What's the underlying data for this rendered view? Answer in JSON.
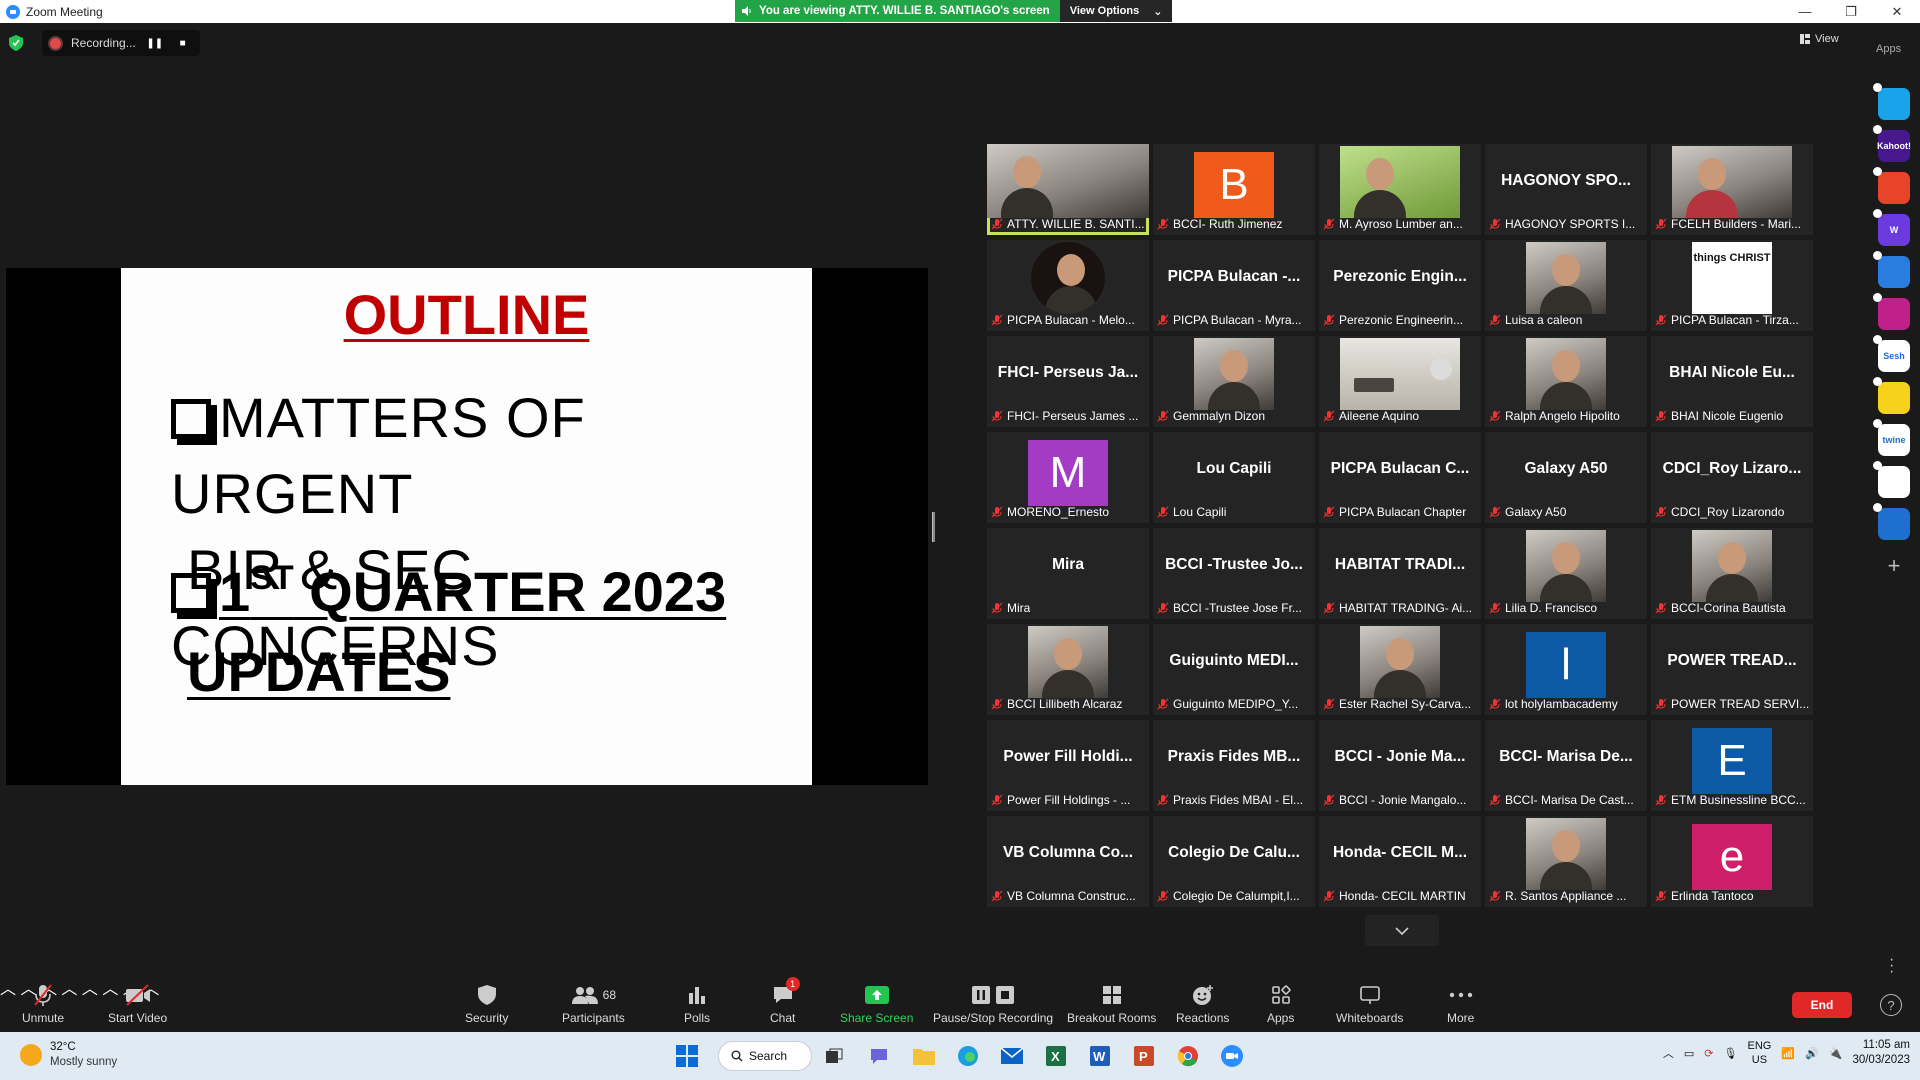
{
  "window": {
    "title": "Zoom Meeting",
    "viewing_banner": "You are viewing ATTY. WILLIE B. SANTIAGO's screen",
    "view_options": "View Options"
  },
  "recording": {
    "label": "Recording..."
  },
  "top_right": {
    "view_label": "View",
    "apps_label": "Apps"
  },
  "slide": {
    "title": "OUTLINE",
    "bullet1_line1": "MATTERS OF URGENT",
    "bullet1_line2": "BIR & SEC CONCERNS",
    "bullet2_num": "1",
    "bullet2_sup": "ST",
    "bullet2_line1": " QUARTER 2023",
    "bullet2_line2": "UPDATES"
  },
  "participants": [
    {
      "name": "ATTY. WILLIE B. SANTI...",
      "display": "photo",
      "active": true
    },
    {
      "name": "BCCI- Ruth Jimenez",
      "display": "letter",
      "letter": "B",
      "color": "#f05a1a"
    },
    {
      "name": "M. Ayroso Lumber an...",
      "display": "photo-green"
    },
    {
      "name": "HAGONOY SPORTS I...",
      "display": "text",
      "tile_text": "HAGONOY  SPO..."
    },
    {
      "name": "FCELH Builders - Mari...",
      "display": "photo-red"
    },
    {
      "name": "PICPA Bulacan - Melo...",
      "display": "photo-circle"
    },
    {
      "name": "PICPA Bulacan - Myra...",
      "display": "text",
      "tile_text": "PICPA  Bulacan  -..."
    },
    {
      "name": "Perezonic Engineerin...",
      "display": "text",
      "tile_text": "Perezonic  Engin..."
    },
    {
      "name": "Luisa a caleon",
      "display": "photo"
    },
    {
      "name": "PICPA Bulacan - Tirza...",
      "display": "photo-text",
      "photo_text": "things CHRIST"
    },
    {
      "name": "FHCI- Perseus James ...",
      "display": "text",
      "tile_text": "FHCI-  Perseus  Ja..."
    },
    {
      "name": "Gemmalyn Dizon",
      "display": "photo"
    },
    {
      "name": "Aileene Aquino",
      "display": "photo-room"
    },
    {
      "name": "Ralph Angelo Hipolito",
      "display": "photo"
    },
    {
      "name": "BHAI Nicole Eugenio",
      "display": "text",
      "tile_text": "BHAI  Nicole  Eu..."
    },
    {
      "name": "MORENO_Ernesto",
      "display": "letter",
      "letter": "M",
      "color": "#a43bc4"
    },
    {
      "name": "Lou  Capili",
      "display": "text",
      "tile_text": "Lou  Capili"
    },
    {
      "name": "PICPA Bulacan Chapter",
      "display": "text",
      "tile_text": "PICPA  Bulacan  C..."
    },
    {
      "name": "Galaxy A50",
      "display": "text",
      "tile_text": "Galaxy  A50"
    },
    {
      "name": "CDCI_Roy Lizarondo",
      "display": "text",
      "tile_text": "CDCI_Roy  Lizaro..."
    },
    {
      "name": "Mira",
      "display": "text",
      "tile_text": "Mira"
    },
    {
      "name": "BCCI -Trustee Jose Fr...",
      "display": "text",
      "tile_text": "BCCI  -Trustee  Jo..."
    },
    {
      "name": "HABITAT TRADING- Ai...",
      "display": "text",
      "tile_text": "HABITAT  TRADI..."
    },
    {
      "name": "Lilia D. Francisco",
      "display": "photo"
    },
    {
      "name": "BCCI-Corina Bautista",
      "display": "photo"
    },
    {
      "name": "BCCI Lillibeth Alcaraz",
      "display": "photo"
    },
    {
      "name": "Guiguinto MEDIPO_Y...",
      "display": "text",
      "tile_text": "Guiguinto  MEDI..."
    },
    {
      "name": "Ester Rachel Sy-Carva...",
      "display": "photo"
    },
    {
      "name": "lot holylambacademy",
      "display": "letter",
      "letter": "l",
      "color": "#0c5aa6"
    },
    {
      "name": "POWER TREAD SERVI...",
      "display": "text",
      "tile_text": "POWER  TREAD..."
    },
    {
      "name": "Power Fill Holdings - ...",
      "display": "text",
      "tile_text": "Power  Fill  Holdi..."
    },
    {
      "name": "Praxis Fides MBAI - El...",
      "display": "text",
      "tile_text": "Praxis  Fides  MB..."
    },
    {
      "name": "BCCI - Jonie Mangalo...",
      "display": "text",
      "tile_text": "BCCI  -  Jonie  Ma..."
    },
    {
      "name": "BCCI- Marisa De Cast...",
      "display": "text",
      "tile_text": "BCCI-  Marisa  De..."
    },
    {
      "name": "ETM Businessline BCC...",
      "display": "letter",
      "letter": "E",
      "color": "#0c5aa6"
    },
    {
      "name": "VB Columna Construc...",
      "display": "text",
      "tile_text": "VB  Columna  Co..."
    },
    {
      "name": "Colegio De Calumpit,I...",
      "display": "text",
      "tile_text": "Colegio  De  Calu..."
    },
    {
      "name": "Honda- CECIL MARTIN",
      "display": "text",
      "tile_text": "Honda-  CECIL  M..."
    },
    {
      "name": "R. Santos Appliance ...",
      "display": "photo"
    },
    {
      "name": "Erlinda Tantoco",
      "display": "letter",
      "letter": "e",
      "color": "#d01f6a"
    }
  ],
  "side_apps": [
    {
      "icon": "play-app-icon",
      "color": "#1aa3e8",
      "text": ""
    },
    {
      "icon": "kahoot-app-icon",
      "color": "#46178f",
      "text": "Kahoot!"
    },
    {
      "icon": "red-app-icon",
      "color": "#e8442a",
      "text": ""
    },
    {
      "icon": "wooclap-app-icon",
      "color": "#6c3be0",
      "text": "W"
    },
    {
      "icon": "bot-app-icon",
      "color": "#2a7de0",
      "text": ""
    },
    {
      "icon": "video-app-icon",
      "color": "#c0208a",
      "text": ""
    },
    {
      "icon": "sesh-app-icon",
      "color": "#ffffff",
      "text": "Sesh"
    },
    {
      "icon": "emoji-app-icon",
      "color": "#f7d21a",
      "text": ""
    },
    {
      "icon": "twine-app-icon",
      "color": "#ffffff",
      "text": "twine"
    },
    {
      "icon": "grid-app-icon",
      "color": "#ffffff",
      "text": ""
    },
    {
      "icon": "sync-app-icon",
      "color": "#1f6fd0",
      "text": ""
    }
  ],
  "toolbar": {
    "unmute": "Unmute",
    "start_video": "Start Video",
    "security": "Security",
    "participants": "Participants",
    "participants_count": "68",
    "polls": "Polls",
    "chat": "Chat",
    "chat_badge": "1",
    "share_screen": "Share Screen",
    "pause_stop_recording": "Pause/Stop Recording",
    "breakout_rooms": "Breakout Rooms",
    "reactions": "Reactions",
    "apps": "Apps",
    "whiteboards": "Whiteboards",
    "more": "More",
    "end": "End"
  },
  "taskbar": {
    "temperature": "32°C",
    "weather": "Mostly sunny",
    "search": "Search",
    "lang1": "ENG",
    "lang2": "US",
    "time": "11:05 am",
    "date": "30/03/2023"
  }
}
